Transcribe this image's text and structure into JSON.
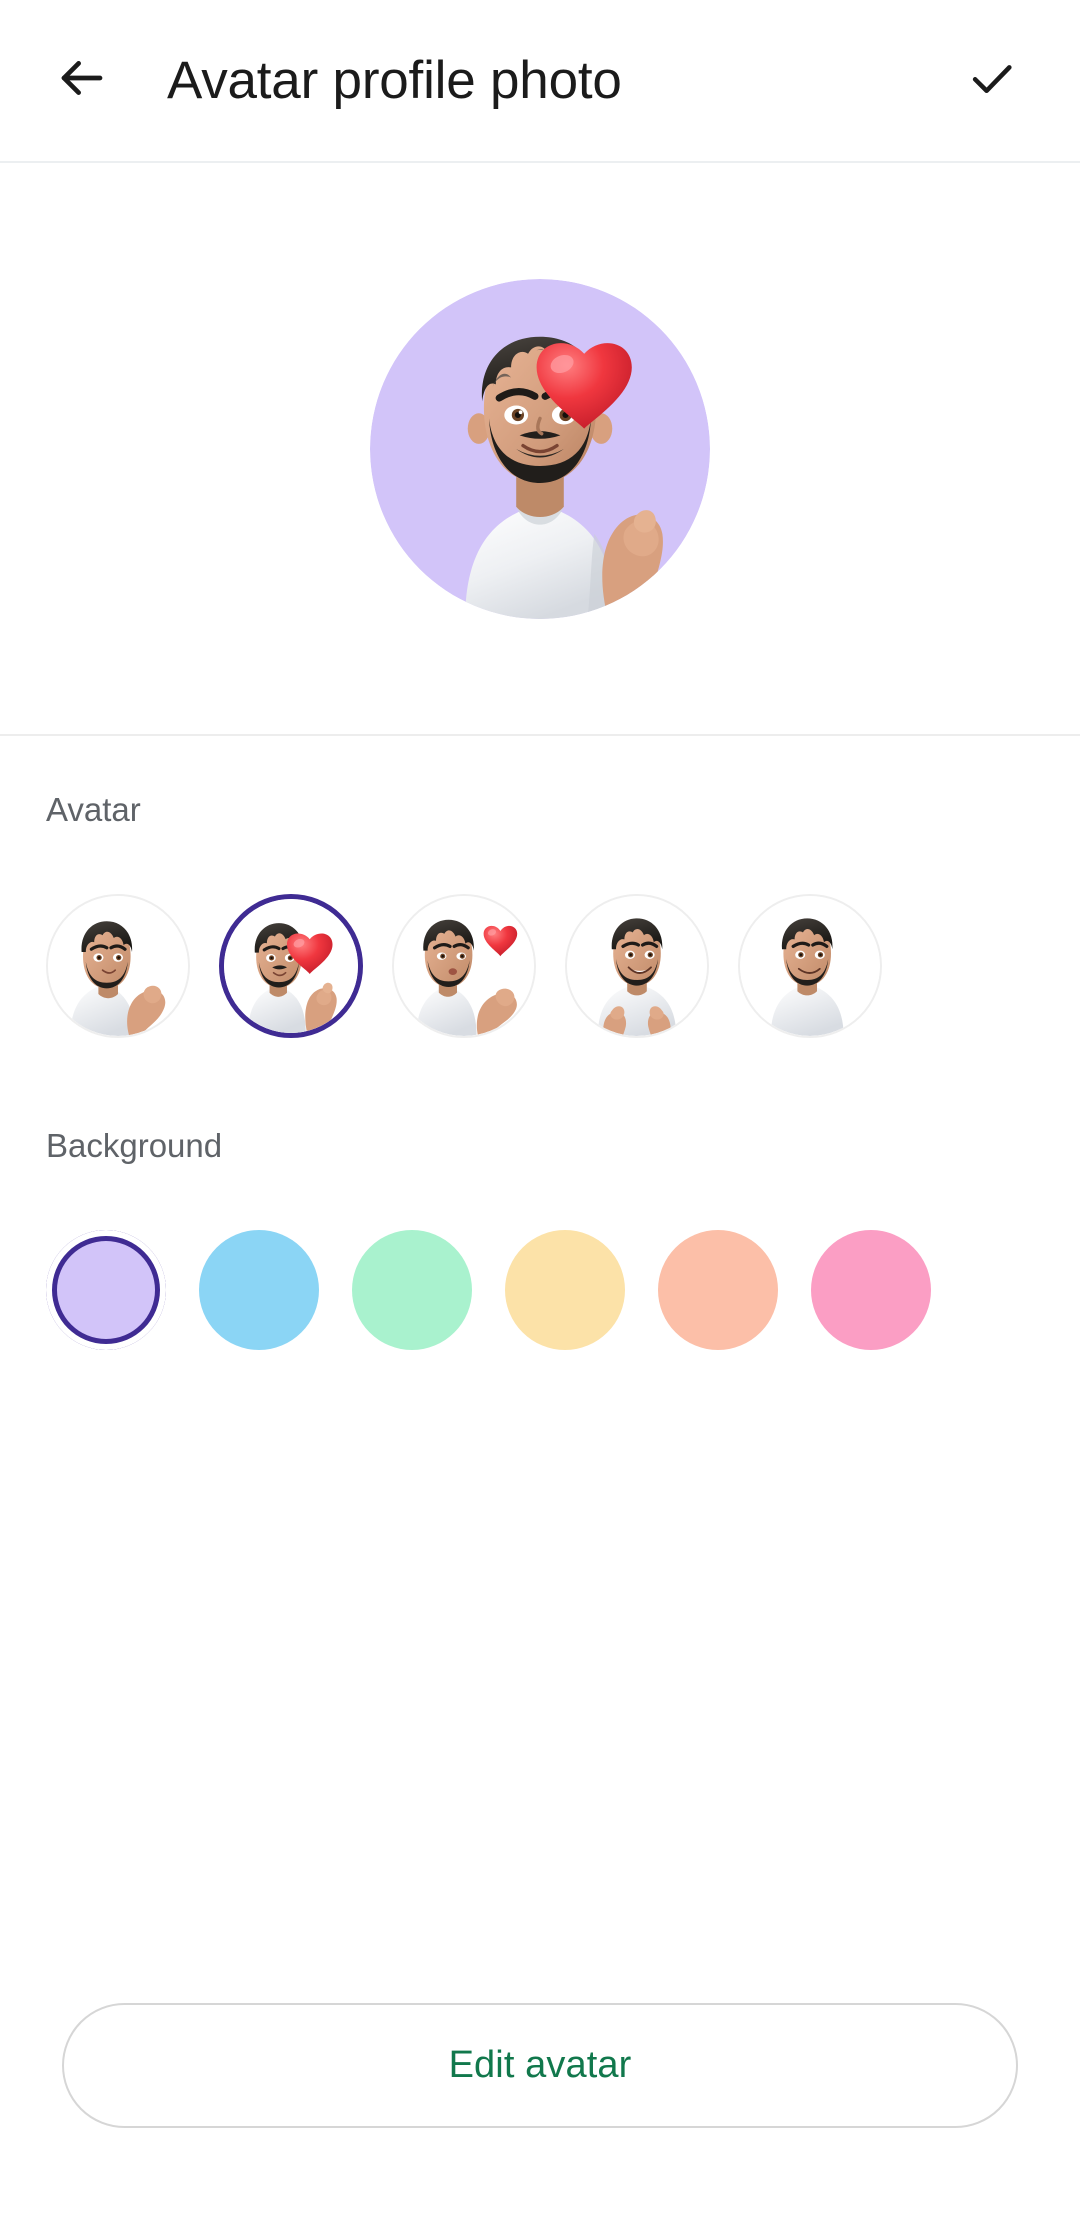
{
  "app": {
    "title": "Avatar profile photo"
  },
  "header": {
    "back_icon": "arrow-left-icon",
    "title": "Avatar profile photo",
    "confirm_icon": "check-icon"
  },
  "preview": {
    "background_color": "#D2C4F9",
    "selected_avatar_index": 1,
    "description": "avatar-preview"
  },
  "avatar_section": {
    "label": "Avatar",
    "selected_index": 1,
    "items": [
      {
        "name": "avatar-option-arms-crossed",
        "pose": "arms-crossed"
      },
      {
        "name": "avatar-option-heart-hands",
        "pose": "heart-hands"
      },
      {
        "name": "avatar-option-blow-kiss",
        "pose": "blow-kiss"
      },
      {
        "name": "avatar-option-thumbs-up",
        "pose": "thumbs-up"
      },
      {
        "name": "avatar-option-partial",
        "pose": "partial"
      }
    ]
  },
  "background_section": {
    "label": "Background",
    "selected_index": 0,
    "ring_color": "#3F2B93",
    "swatches": [
      {
        "name": "background-swatch-lavender",
        "color": "#D2C4F9"
      },
      {
        "name": "background-swatch-sky-blue",
        "color": "#8BD5F5"
      },
      {
        "name": "background-swatch-mint",
        "color": "#A9F2CE"
      },
      {
        "name": "background-swatch-butter-yellow",
        "color": "#FCE2A8"
      },
      {
        "name": "background-swatch-salmon",
        "color": "#FCBFA8"
      },
      {
        "name": "background-swatch-pink",
        "color": "#FB9EC4"
      }
    ]
  },
  "footer": {
    "edit_avatar_label": "Edit avatar",
    "edit_avatar_color": "#11784C"
  }
}
